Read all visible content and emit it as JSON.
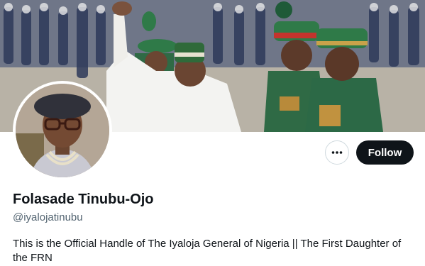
{
  "profile": {
    "display_name": "Folasade Tinubu-Ojo",
    "handle": "@iyalojatinubu",
    "bio": "This is the Official Handle of The Iyaloja General of Nigeria || The First Daughter of the FRN"
  },
  "actions": {
    "follow_label": "Follow",
    "more_icon": "more-horizontal-icon"
  },
  "colors": {
    "primary_text": "#0f1419",
    "secondary_text": "#536471",
    "follow_bg": "#0f1419",
    "border": "#cfd9de"
  }
}
